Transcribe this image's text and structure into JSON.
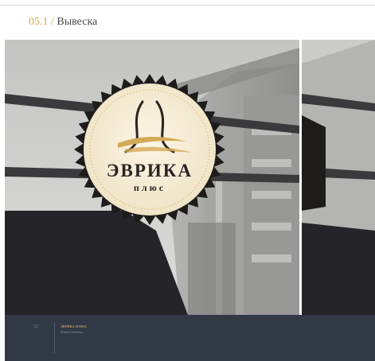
{
  "section": {
    "number": "05.1",
    "separator": " / ",
    "title": "Вывеска"
  },
  "sign": {
    "name": "ЭВРИКА",
    "subtitle": "плюс"
  },
  "footer": {
    "page": "32",
    "brand": "ЭВРИКА ПЛЮС",
    "subtitle": "Brand Guidelines"
  },
  "colors": {
    "gold": "#d4aa57",
    "badge": "#f4ebd5",
    "badge_edge": "#1e1c1b",
    "footer_bg": "#313846",
    "logo_dark": "#2a2522"
  }
}
